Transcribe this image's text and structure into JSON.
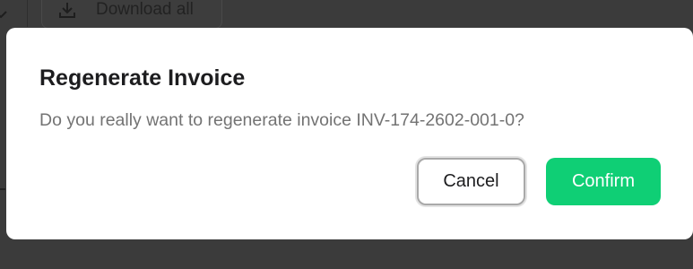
{
  "background": {
    "download_all_label": "Download all",
    "download_icon": "download-icon",
    "chevron_icon": "chevron-down-icon"
  },
  "dialog": {
    "title": "Regenerate Invoice",
    "message": "Do you really want to regenerate invoice INV-174-2602-001-0?",
    "cancel_label": "Cancel",
    "confirm_label": "Confirm"
  },
  "colors": {
    "overlay": "#3b3b3b",
    "dialog_bg": "#ffffff",
    "title_text": "#1d1d1f",
    "message_text": "#737373",
    "confirm_bg": "#0fcf75",
    "confirm_text": "#ffffff",
    "cancel_border": "#a9a9a9"
  }
}
